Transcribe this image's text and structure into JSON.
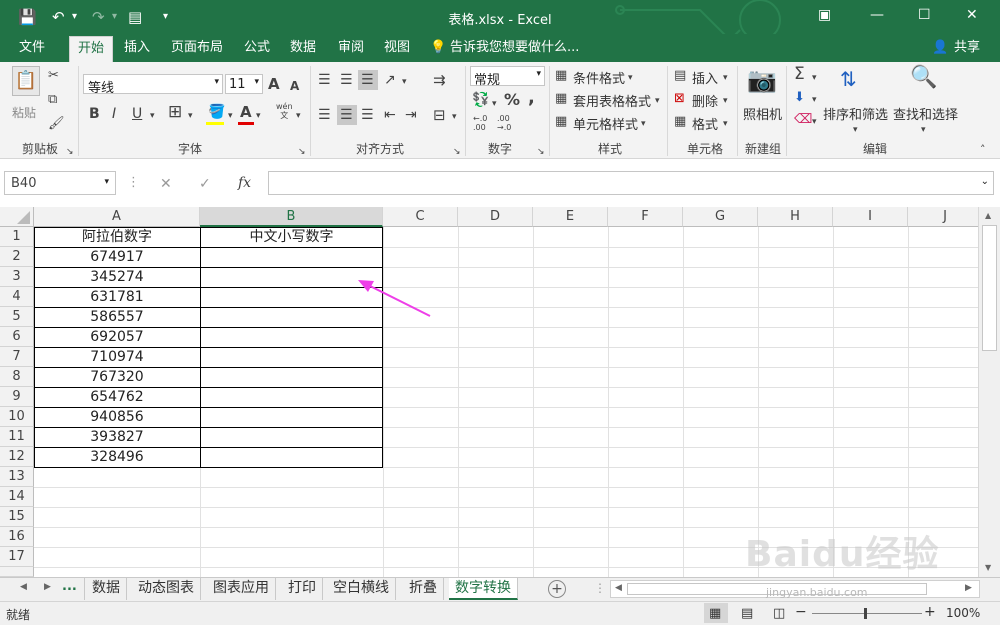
{
  "titlebar": {
    "title": "表格.xlsx - Excel"
  },
  "tabs": [
    "文件",
    "开始",
    "插入",
    "页面布局",
    "公式",
    "数据",
    "审阅",
    "视图"
  ],
  "tell_me": "告诉我您想要做什么...",
  "share": "共享",
  "ribbon": {
    "clipboard": {
      "paste": "粘贴",
      "label": "剪贴板"
    },
    "font": {
      "name": "等线",
      "size": "11",
      "label": "字体",
      "bold": "B",
      "italic": "I",
      "underline": "U",
      "grow": "A",
      "shrink": "A",
      "font_color": "A",
      "phonetic": "wén\n文"
    },
    "alignment": {
      "label": "对齐方式"
    },
    "number": {
      "format": "常规",
      "label": "数字",
      "percent": "%",
      "comma": ",",
      "inc_dec": "←.0\n.00",
      "dec_dec": ".00\n→.0"
    },
    "styles": {
      "conditional": "条件格式",
      "table": "套用表格格式",
      "cell": "单元格样式",
      "label": "样式"
    },
    "cells": {
      "insert": "插入",
      "delete": "删除",
      "format": "格式",
      "label": "单元格"
    },
    "newgroup": {
      "camera": "照相机",
      "label": "新建组"
    },
    "editing": {
      "sigma": "Σ",
      "sort": "排序和筛选",
      "find": "查找和选择",
      "label": "编辑"
    }
  },
  "formula_bar": {
    "name_box": "B40",
    "cancel": "✕",
    "enter": "✓",
    "fx": "fx",
    "value": ""
  },
  "columns": [
    "A",
    "B",
    "C",
    "D",
    "E",
    "F",
    "G",
    "H",
    "I",
    "J"
  ],
  "rows": [
    "1",
    "2",
    "3",
    "4",
    "5",
    "6",
    "7",
    "8",
    "9",
    "10",
    "11",
    "12",
    "13",
    "14",
    "15",
    "16",
    "17"
  ],
  "table": {
    "header_a": "阿拉伯数字",
    "header_b": "中文小写数字",
    "values": [
      "674917",
      "345274",
      "631781",
      "586557",
      "692057",
      "710974",
      "767320",
      "654762",
      "940856",
      "393827",
      "328496"
    ]
  },
  "sheet_tabs": {
    "ellipsis": "...",
    "items": [
      "数据",
      "动态图表",
      "图表应用",
      "打印",
      "空白横线",
      "折叠",
      "数字转换"
    ],
    "active": "数字转换",
    "add": "+"
  },
  "status": {
    "ready": "就绪",
    "zoom": "100%",
    "minus": "−",
    "plus": "+"
  },
  "watermark": {
    "brand": "Baidu经验",
    "url": "jingyan.baidu.com"
  },
  "colors": {
    "excel_green": "#217346",
    "arrow": "#ee3ee8"
  }
}
